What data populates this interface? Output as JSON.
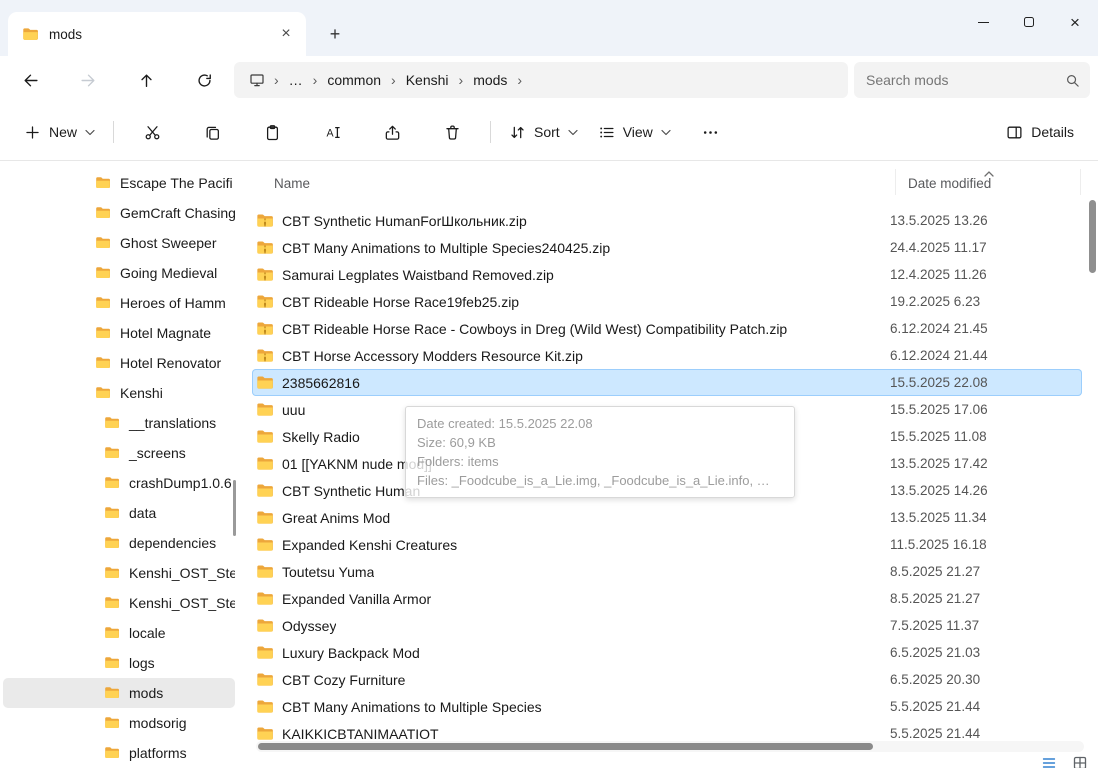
{
  "window": {
    "tab_title": "mods"
  },
  "navbar": {
    "ellipsis": "…",
    "separator": "›",
    "breadcrumb": [
      "common",
      "Kenshi",
      "mods"
    ],
    "search_placeholder": "Search mods"
  },
  "toolbar": {
    "new_label": "New",
    "sort_label": "Sort",
    "view_label": "View",
    "details_label": "Details"
  },
  "sidebar": {
    "items": [
      {
        "label": "Escape The Pacifi",
        "child": false,
        "selected": false
      },
      {
        "label": "GemCraft Chasing",
        "child": false,
        "selected": false
      },
      {
        "label": "Ghost Sweeper",
        "child": false,
        "selected": false
      },
      {
        "label": "Going Medieval",
        "child": false,
        "selected": false
      },
      {
        "label": "Heroes of Hamm",
        "child": false,
        "selected": false
      },
      {
        "label": "Hotel Magnate",
        "child": false,
        "selected": false
      },
      {
        "label": "Hotel Renovator",
        "child": false,
        "selected": false
      },
      {
        "label": "Kenshi",
        "child": false,
        "selected": false
      },
      {
        "label": "__translations",
        "child": true,
        "selected": false
      },
      {
        "label": "_screens",
        "child": true,
        "selected": false
      },
      {
        "label": "crashDump1.0.6",
        "child": true,
        "selected": false
      },
      {
        "label": "data",
        "child": true,
        "selected": false
      },
      {
        "label": "dependencies",
        "child": true,
        "selected": false
      },
      {
        "label": "Kenshi_OST_Ste",
        "child": true,
        "selected": false
      },
      {
        "label": "Kenshi_OST_Ste",
        "child": true,
        "selected": false
      },
      {
        "label": "locale",
        "child": true,
        "selected": false
      },
      {
        "label": "logs",
        "child": true,
        "selected": false
      },
      {
        "label": "mods",
        "child": true,
        "selected": true
      },
      {
        "label": "modsorig",
        "child": true,
        "selected": false
      },
      {
        "label": "platforms",
        "child": true,
        "selected": false
      }
    ]
  },
  "filelist": {
    "columns": [
      "Name",
      "Date modified"
    ],
    "rows": [
      {
        "name": "CBT Synthetic HumanForШкольник.zip",
        "date": "13.5.2025 13.26",
        "type": "zip",
        "selected": false
      },
      {
        "name": "CBT Many Animations to Multiple Species240425.zip",
        "date": "24.4.2025 11.17",
        "type": "zip",
        "selected": false
      },
      {
        "name": "Samurai Legplates Waistband Removed.zip",
        "date": "12.4.2025 11.26",
        "type": "zip",
        "selected": false
      },
      {
        "name": "CBT Rideable Horse Race19feb25.zip",
        "date": "19.2.2025 6.23",
        "type": "zip",
        "selected": false
      },
      {
        "name": "CBT Rideable Horse Race - Cowboys in Dreg (Wild West) Compatibility Patch.zip",
        "date": "6.12.2024 21.45",
        "type": "zip",
        "selected": false
      },
      {
        "name": "CBT Horse Accessory Modders Resource Kit.zip",
        "date": "6.12.2024 21.44",
        "type": "zip",
        "selected": false
      },
      {
        "name": "2385662816",
        "date": "15.5.2025 22.08",
        "type": "folder",
        "selected": true
      },
      {
        "name": "uuu",
        "date": "15.5.2025 17.06",
        "type": "folder",
        "selected": false
      },
      {
        "name": "Skelly Radio",
        "date": "15.5.2025 11.08",
        "type": "folder",
        "selected": false
      },
      {
        "name": "01 [[YAKNM nude mod]]",
        "date": "13.5.2025 17.42",
        "type": "folder",
        "selected": false
      },
      {
        "name": "CBT Synthetic Human",
        "date": "13.5.2025 14.26",
        "type": "folder",
        "selected": false
      },
      {
        "name": "Great Anims Mod",
        "date": "13.5.2025 11.34",
        "type": "folder",
        "selected": false
      },
      {
        "name": "Expanded Kenshi Creatures",
        "date": "11.5.2025 16.18",
        "type": "folder",
        "selected": false
      },
      {
        "name": "Toutetsu Yuma",
        "date": "8.5.2025 21.27",
        "type": "folder",
        "selected": false
      },
      {
        "name": "Expanded Vanilla Armor",
        "date": "8.5.2025 21.27",
        "type": "folder",
        "selected": false
      },
      {
        "name": "Odyssey",
        "date": "7.5.2025 11.37",
        "type": "folder",
        "selected": false
      },
      {
        "name": "Luxury Backpack Mod",
        "date": "6.5.2025 21.03",
        "type": "folder",
        "selected": false
      },
      {
        "name": "CBT Cozy Furniture",
        "date": "6.5.2025 20.30",
        "type": "folder",
        "selected": false
      },
      {
        "name": "CBT Many Animations to Multiple Species",
        "date": "5.5.2025 21.44",
        "type": "folder",
        "selected": false
      },
      {
        "name": "KAIKKICBTANIMAATIOT",
        "date": "5.5.2025 21.44",
        "type": "folder",
        "selected": false
      }
    ]
  },
  "tooltip": {
    "date_created": "Date created: 15.5.2025 22.08",
    "size": "Size: 60,9 KB",
    "folders": "Folders: items",
    "files": "Files: _Foodcube_is_a_Lie.img, _Foodcube_is_a_Lie.info, …"
  },
  "colors": {
    "selection_fill": "#cde8ff",
    "selection_border": "#9ccefc",
    "folder_yellow": "#ffd254",
    "accent_blue": "#0b69c7"
  }
}
